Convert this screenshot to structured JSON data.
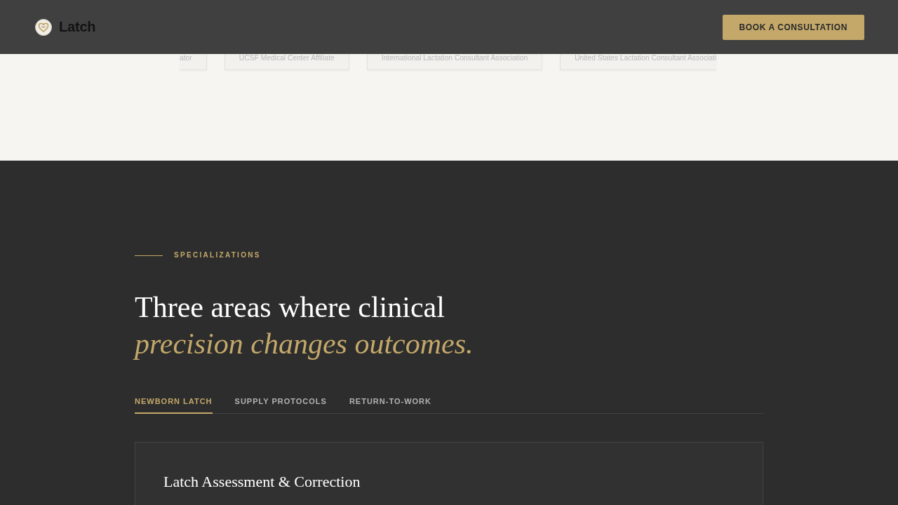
{
  "header": {
    "logo": {
      "name": "Latch"
    },
    "cta": "BOOK A CONSULTATION"
  },
  "credentials": [
    {
      "kind": "cutleft",
      "label": "ator"
    },
    {
      "kind": "full",
      "label": "UCSF Medical Center Affiliate"
    },
    {
      "kind": "full",
      "label": "International Lactation Consultant Association"
    },
    {
      "kind": "cutright",
      "label": "United States Lactation Consultant Associati"
    }
  ],
  "specializations": {
    "eyebrow": "SPECIALIZATIONS",
    "heading": {
      "line_1": "Three areas where clinical",
      "line_2": "precision changes outcomes."
    },
    "tabs": [
      {
        "label": "NEWBORN LATCH",
        "selected": true
      },
      {
        "label": "SUPPLY PROTOCOLS",
        "selected": false
      },
      {
        "label": "RETURN-TO-WORK",
        "selected": false
      }
    ],
    "panel": {
      "title": "Latch Assessment & Correction"
    }
  }
}
